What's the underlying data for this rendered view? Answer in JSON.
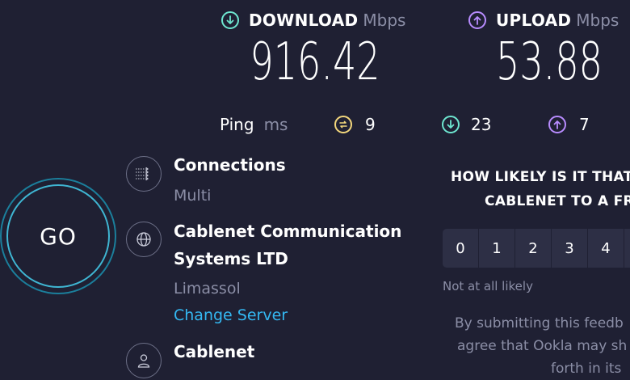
{
  "colors": {
    "background": "#1f2033",
    "download_accent": "#6ee6d0",
    "upload_accent": "#b88cff",
    "ping_accent": "#f3d77c",
    "link": "#34b8f2",
    "go_ring": "#3fb6d3"
  },
  "download": {
    "label": "DOWNLOAD",
    "unit": "Mbps",
    "value": "916.42",
    "icon": "download-arrow-icon"
  },
  "upload": {
    "label": "UPLOAD",
    "unit": "Mbps",
    "value": "53.88",
    "icon": "upload-arrow-icon"
  },
  "ping": {
    "label": "Ping",
    "unit": "ms",
    "idle": "9",
    "download": "23",
    "upload": "7"
  },
  "go": {
    "label": "GO"
  },
  "connections": {
    "title": "Connections",
    "value": "Multi",
    "icon": "connections-icon"
  },
  "server": {
    "title_line1": "Cablenet Communication",
    "title_line2": "Systems LTD",
    "location": "Limassol",
    "change_label": "Change Server",
    "icon": "globe-icon"
  },
  "provider": {
    "title": "Cablenet",
    "icon": "user-icon"
  },
  "survey": {
    "question_line1": "HOW LIKELY IS IT THAT Y",
    "question_line2": "CABLENET TO A FRI",
    "scale": [
      "0",
      "1",
      "2",
      "3",
      "4"
    ],
    "low_label": "Not at all likely",
    "feedback_line1": "By submitting this feedb",
    "feedback_line2": "agree that Ookla may sh",
    "feedback_line3": "forth in its"
  }
}
